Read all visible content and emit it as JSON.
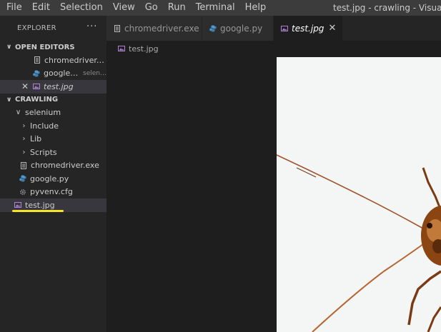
{
  "menubar": {
    "items": [
      "File",
      "Edit",
      "Selection",
      "View",
      "Go",
      "Run",
      "Terminal",
      "Help"
    ],
    "window_title": "test.jpg - crawling - Visual St"
  },
  "sidebar": {
    "title": "EXPLORER",
    "more_label": "···",
    "open_editors": {
      "header": "OPEN EDITORS",
      "items": [
        {
          "name": "chromedriver.ex...",
          "desc": ""
        },
        {
          "name": "google.py",
          "desc": "seleni..."
        },
        {
          "name": "test.jpg",
          "desc": ""
        }
      ]
    },
    "project": {
      "header": "CRAWLING",
      "tree": [
        {
          "name": "selenium"
        },
        {
          "name": "Include"
        },
        {
          "name": "Lib"
        },
        {
          "name": "Scripts"
        },
        {
          "name": "chromedriver.exe"
        },
        {
          "name": "google.py"
        },
        {
          "name": "pyvenv.cfg"
        },
        {
          "name": "test.jpg"
        }
      ]
    }
  },
  "tabs": [
    {
      "label": "chromedriver.exe"
    },
    {
      "label": "google.py"
    },
    {
      "label": "test.jpg"
    }
  ],
  "breadcrumb": {
    "file": "test.jpg"
  },
  "colors": {
    "highlight": "#f5e42a",
    "python_icon": "#4a9ad5",
    "image_icon": "#b180d7",
    "file_icon": "#b8b8b8"
  }
}
